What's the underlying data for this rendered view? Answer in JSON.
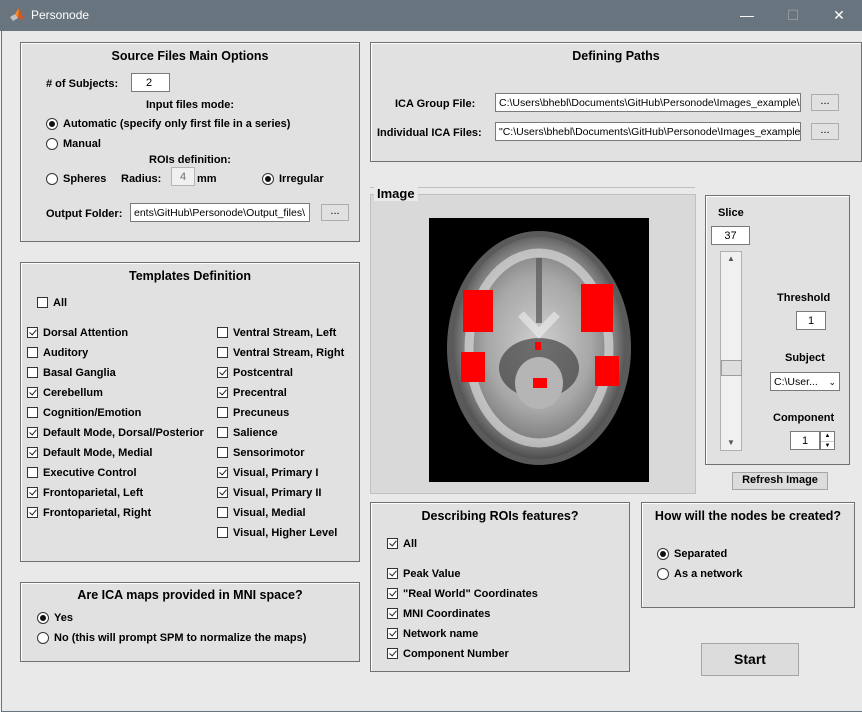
{
  "window": {
    "title": "Personode",
    "minimize": "—",
    "maximize": "☐",
    "close": "✕"
  },
  "source": {
    "title": "Source Files Main Options",
    "subjects_label": "# of Subjects:",
    "subjects_value": "2",
    "input_mode_label": "Input files mode:",
    "mode_automatic": "Automatic (specify only first file in a series)",
    "mode_manual": "Manual",
    "rois_label": "ROIs definition:",
    "spheres": "Spheres",
    "radius_label": "Radius:",
    "radius_value": "4",
    "mm": "mm",
    "irregular": "Irregular",
    "output_label": "Output Folder:",
    "output_value": "ents\\GitHub\\Personode\\Output_files\\",
    "browse": "..."
  },
  "paths": {
    "title": "Defining Paths",
    "group_label": "ICA Group File:",
    "group_value": "C:\\Users\\bhebl\\Documents\\GitHub\\Personode\\Images_example\\",
    "individual_label": "Individual ICA Files:",
    "individual_value": "\"C:\\Users\\bhebl\\Documents\\GitHub\\Personode\\Images_example\\",
    "browse": "..."
  },
  "templates": {
    "title": "Templates Definition",
    "all": "All",
    "left": [
      {
        "label": "Dorsal Attention",
        "checked": true
      },
      {
        "label": "Auditory",
        "checked": false
      },
      {
        "label": "Basal Ganglia",
        "checked": false
      },
      {
        "label": "Cerebellum",
        "checked": true
      },
      {
        "label": "Cognition/Emotion",
        "checked": false
      },
      {
        "label": "Default Mode, Dorsal/Posterior",
        "checked": true
      },
      {
        "label": "Default Mode, Medial",
        "checked": true
      },
      {
        "label": "Executive Control",
        "checked": false
      },
      {
        "label": "Frontoparietal, Left",
        "checked": true
      },
      {
        "label": "Frontoparietal, Right",
        "checked": true
      }
    ],
    "right": [
      {
        "label": "Ventral Stream, Left",
        "checked": false
      },
      {
        "label": "Ventral Stream, Right",
        "checked": false
      },
      {
        "label": "Postcentral",
        "checked": true
      },
      {
        "label": "Precentral",
        "checked": true
      },
      {
        "label": "Precuneus",
        "checked": false
      },
      {
        "label": "Salience",
        "checked": false
      },
      {
        "label": "Sensorimotor",
        "checked": false
      },
      {
        "label": "Visual, Primary I",
        "checked": true
      },
      {
        "label": "Visual, Primary II",
        "checked": true
      },
      {
        "label": "Visual, Medial",
        "checked": false
      },
      {
        "label": "Visual, Higher Level",
        "checked": false
      }
    ]
  },
  "mni": {
    "title": "Are ICA maps provided in MNI space?",
    "yes": "Yes",
    "no": "No (this will prompt SPM to normalize the maps)"
  },
  "image": {
    "title": "Image"
  },
  "slice": {
    "label": "Slice",
    "value": "37",
    "slider_position": 0.6,
    "threshold_label": "Threshold",
    "threshold_value": "1",
    "subject_label": "Subject",
    "subject_value": "C:\\User...",
    "component_label": "Component",
    "component_value": "1",
    "refresh": "Refresh Image"
  },
  "features": {
    "title": "Describing ROIs features?",
    "all": "All",
    "items": [
      "Peak Value",
      "\"Real World\" Coordinates",
      "MNI Coordinates",
      "Network name",
      "Component Number"
    ]
  },
  "nodes": {
    "title": "How will the nodes be created?",
    "separated": "Separated",
    "network": "As a network"
  },
  "start": "Start"
}
